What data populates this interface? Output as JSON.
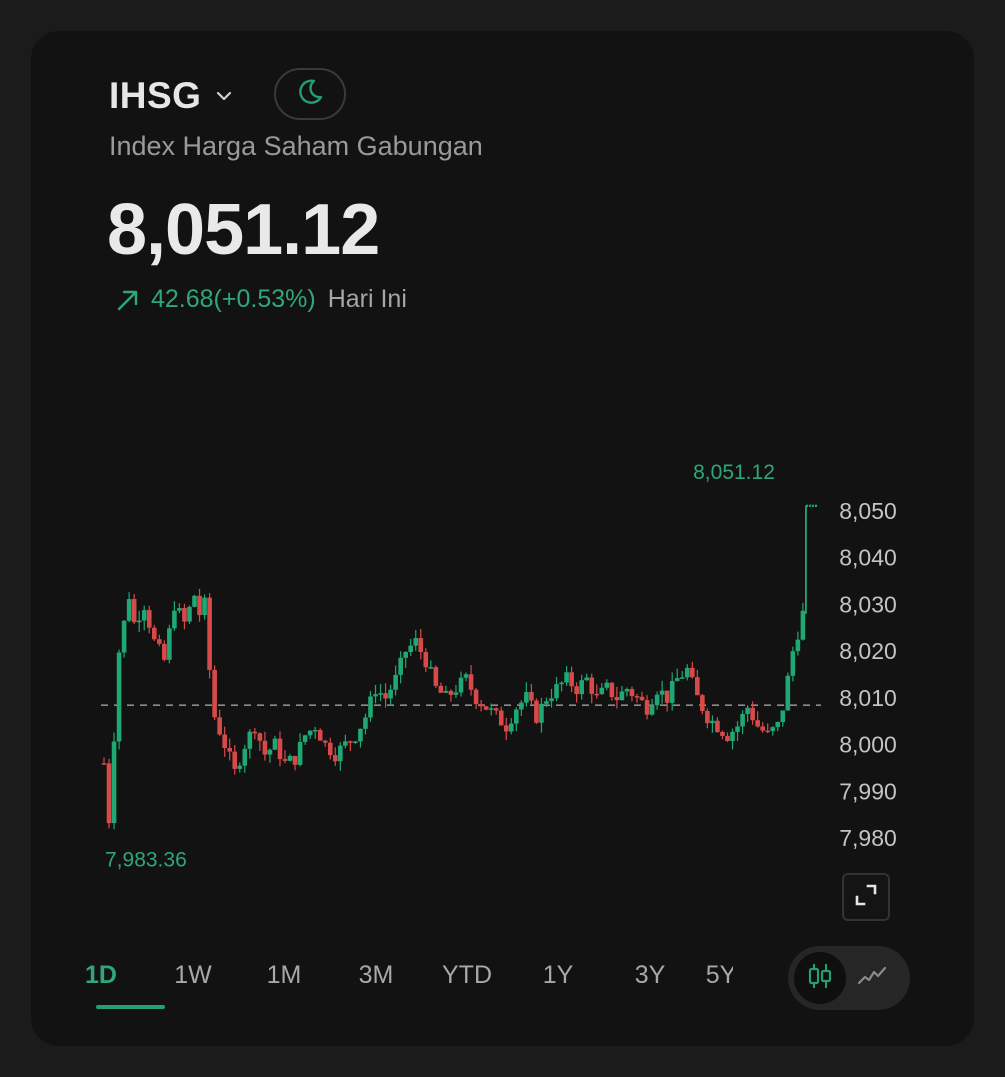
{
  "header": {
    "ticker": "IHSG",
    "name": "Index Harga Saham Gabungan",
    "price": "8,051.12",
    "change": "42.68(+0.53%)",
    "period": "Hari Ini"
  },
  "colors": {
    "up": "#1fa873",
    "down": "#d84a4a",
    "accent": "#22a06f",
    "card_bg": "#121212",
    "page_bg": "#1b1b1b"
  },
  "icons": {
    "dropdown": "chevron-down-icon",
    "theme": "moon-icon",
    "change": "arrow-up-right-icon",
    "expand": "expand-icon",
    "candle_mode": "candlestick-icon",
    "line_mode": "line-chart-icon"
  },
  "ranges": [
    "1D",
    "1W",
    "1M",
    "3M",
    "YTD",
    "1Y",
    "3Y",
    "5Y"
  ],
  "active_range": "1D",
  "chart_data": {
    "type": "bar",
    "series_style": "candlestick",
    "y_ticks": [
      "8,050",
      "8,040",
      "8,030",
      "8,020",
      "8,010",
      "8,000",
      "7,990",
      "7,980"
    ],
    "ylim": [
      7977,
      8058
    ],
    "previous_close": 8008.44,
    "high": 8051.12,
    "high_label": "8,051.12",
    "low": 7983.36,
    "low_label": "7,983.36",
    "last": 8051.12,
    "grid": false,
    "legend": "none",
    "path": [
      [
        0,
        7996
      ],
      [
        1,
        7984
      ],
      [
        3,
        8020
      ],
      [
        5,
        8032
      ],
      [
        6,
        8026
      ],
      [
        8,
        8030
      ],
      [
        10,
        8022
      ],
      [
        12,
        8018
      ],
      [
        14,
        8030
      ],
      [
        16,
        8026
      ],
      [
        18,
        8032
      ],
      [
        19,
        8028
      ],
      [
        20,
        8030
      ],
      [
        21,
        8016
      ],
      [
        22,
        8006
      ],
      [
        24,
        8000
      ],
      [
        26,
        7994
      ],
      [
        28,
        8000
      ],
      [
        30,
        8004
      ],
      [
        32,
        7998
      ],
      [
        34,
        8000
      ],
      [
        36,
        7996
      ],
      [
        38,
        7997
      ],
      [
        40,
        8002
      ],
      [
        42,
        8004
      ],
      [
        44,
        8000
      ],
      [
        46,
        7998
      ],
      [
        48,
        8000
      ],
      [
        50,
        8002
      ],
      [
        52,
        8006
      ],
      [
        54,
        8012
      ],
      [
        56,
        8010
      ],
      [
        58,
        8014
      ],
      [
        60,
        8020
      ],
      [
        62,
        8022
      ],
      [
        64,
        8018
      ],
      [
        66,
        8012
      ],
      [
        68,
        8010
      ],
      [
        70,
        8012
      ],
      [
        72,
        8014
      ],
      [
        74,
        8010
      ],
      [
        76,
        8008
      ],
      [
        78,
        8006
      ],
      [
        80,
        8004
      ],
      [
        82,
        8008
      ],
      [
        84,
        8010
      ],
      [
        86,
        8006
      ],
      [
        88,
        8010
      ],
      [
        90,
        8012
      ],
      [
        92,
        8014
      ],
      [
        94,
        8012
      ],
      [
        96,
        8014
      ],
      [
        98,
        8010
      ],
      [
        100,
        8012
      ],
      [
        102,
        8010
      ],
      [
        104,
        8012
      ],
      [
        106,
        8010
      ],
      [
        108,
        8008
      ],
      [
        110,
        8012
      ],
      [
        112,
        8010
      ],
      [
        114,
        8014
      ],
      [
        116,
        8016
      ],
      [
        118,
        8010
      ],
      [
        120,
        8006
      ],
      [
        122,
        8004
      ],
      [
        124,
        8002
      ],
      [
        126,
        8004
      ],
      [
        128,
        8008
      ],
      [
        130,
        8004
      ],
      [
        132,
        8002
      ],
      [
        134,
        8004
      ],
      [
        135,
        8008
      ],
      [
        136,
        8014
      ],
      [
        137,
        8020
      ],
      [
        138,
        8024
      ],
      [
        139,
        8028
      ],
      [
        140,
        8051
      ],
      [
        142,
        8051
      ]
    ]
  }
}
